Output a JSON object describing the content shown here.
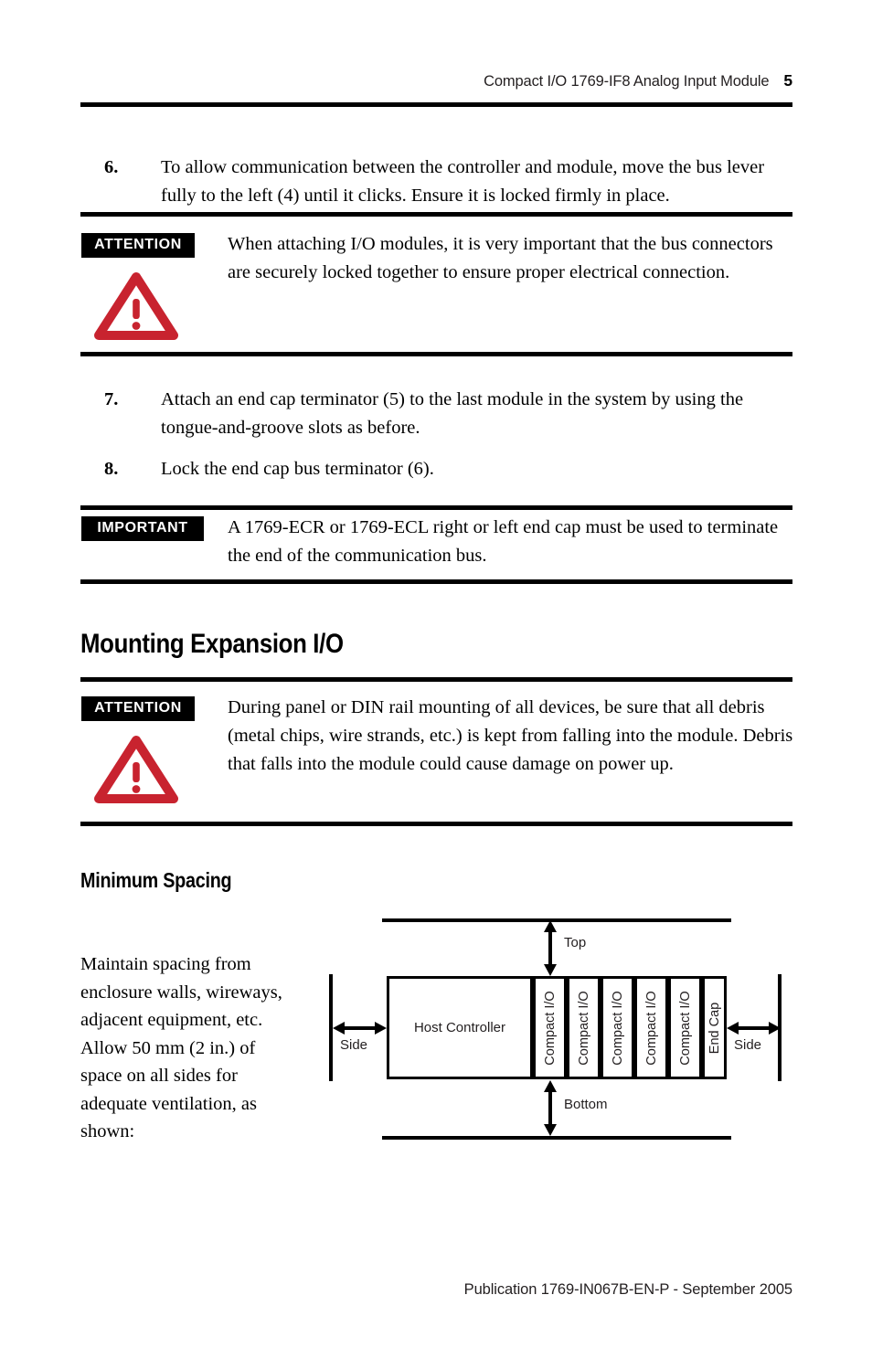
{
  "header": {
    "title": "Compact I/O 1769-IF8 Analog Input Module",
    "page_number": "5"
  },
  "footer": {
    "text": "Publication 1769-IN067B-EN-P - September 2005"
  },
  "colors": {
    "warning_red": "#c8232f",
    "rule_black": "#000000",
    "text": "#231f20"
  },
  "steps": [
    {
      "number": "6.",
      "text": "To allow communication between the controller and module, move the bus lever fully to the left (4) until it clicks. Ensure it is locked firmly in place."
    },
    {
      "number": "7.",
      "text": "Attach an end cap terminator (5) to the last module in the system by using the tongue-and-groove slots as before."
    },
    {
      "number": "8.",
      "text": "Lock the end cap bus terminator (6)."
    }
  ],
  "callouts": {
    "attention_1": {
      "tag": "ATTENTION",
      "icon": "warning-triangle-icon",
      "text": "When attaching I/O modules, it is very important that the bus connectors are securely locked together to ensure proper electrical connection."
    },
    "important_1": {
      "tag": "IMPORTANT",
      "text": "A 1769-ECR or 1769-ECL right or left end cap must be used to terminate the end of the communication bus."
    },
    "attention_2": {
      "tag": "ATTENTION",
      "icon": "warning-triangle-icon",
      "text": "During panel or DIN rail mounting of all devices, be sure that all debris (metal chips, wire strands, etc.) is kept from falling into the module. Debris that falls into the module could cause damage on power up."
    }
  },
  "headings": {
    "mounting_expansion": "Mounting Expansion I/O",
    "minimum_spacing": "Minimum Spacing"
  },
  "spacing_paragraph": "Maintain spacing from enclosure walls, wireways, adjacent equipment, etc. Allow 50 mm (2 in.) of space on all sides for adequate ventilation, as shown:",
  "diagram": {
    "host_controller": "Host Controller",
    "modules": [
      "Compact I/O",
      "Compact I/O",
      "Compact I/O",
      "Compact I/O",
      "Compact I/O"
    ],
    "end_cap": "End Cap",
    "gap_labels": {
      "top": "Top",
      "bottom": "Bottom",
      "side_left": "Side",
      "side_right": "Side"
    }
  }
}
